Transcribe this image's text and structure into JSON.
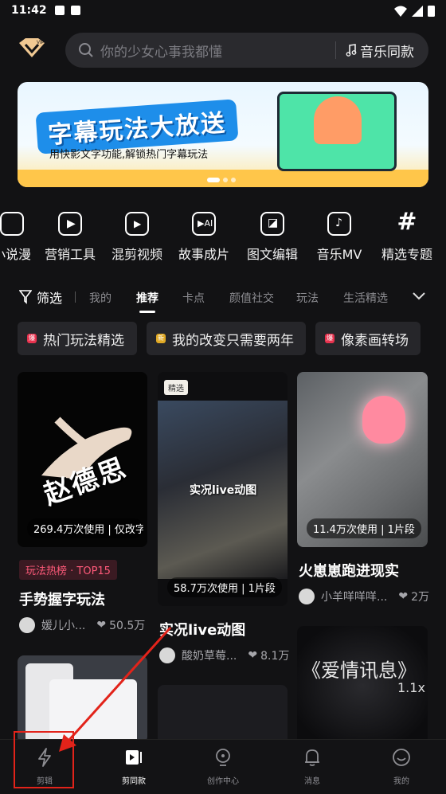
{
  "status": {
    "time": "11:42"
  },
  "search": {
    "placeholder": "你的少女心事我都懂",
    "music_same": "音乐同款"
  },
  "banner": {
    "title": "字幕玩法大放送",
    "subtitle": "用快影文字功能,解锁热门字幕玩法"
  },
  "tools": [
    {
      "label": "小说漫",
      "icon": "novel-comic-icon"
    },
    {
      "label": "营销工具",
      "icon": "marketing-tool-icon"
    },
    {
      "label": "混剪视频",
      "icon": "mix-video-icon"
    },
    {
      "label": "故事成片",
      "icon": "story-video-icon"
    },
    {
      "label": "图文编辑",
      "icon": "image-text-edit-icon"
    },
    {
      "label": "音乐MV",
      "icon": "music-mv-icon"
    },
    {
      "label": "精选专题",
      "icon": "hashtag-icon"
    }
  ],
  "filter": {
    "label": "筛选",
    "tabs": [
      "我的",
      "推荐",
      "卡点",
      "颜值社交",
      "玩法",
      "生活精选"
    ],
    "active": "推荐"
  },
  "chips": [
    {
      "label": "热门玩法精选",
      "badge": "爆",
      "color": "#e8334f"
    },
    {
      "label": "我的改变只需要两年",
      "badge": "新",
      "color": "#e0a925"
    },
    {
      "label": "像素画转场",
      "badge": "爆",
      "color": "#e8334f"
    }
  ],
  "cards": {
    "c1": {
      "stat": "269.4万次使用 | 仅改字",
      "overlay": "赵德思",
      "rank": "玩法热榜 · TOP15",
      "title": "手势握字玩法",
      "author": "媛儿小...",
      "likes": "50.5万"
    },
    "c2": {
      "tag": "精选",
      "overlay": "实况live动图",
      "stat": "58.7万次使用 | 1片段",
      "title": "实况live动图",
      "author": "酸奶草莓...",
      "likes": "8.1万"
    },
    "c3": {
      "stat": "11.4万次使用 | 1片段",
      "title": "火崽崽跑进现实",
      "author": "小羊咩咩咩...",
      "likes": "2万"
    },
    "c6": {
      "overlay": "《爱情讯息》",
      "overlay_sub": "1.1x"
    }
  },
  "nav": [
    {
      "label": "剪辑",
      "icon": "lightning-icon"
    },
    {
      "label": "剪同款",
      "icon": "template-video-icon"
    },
    {
      "label": "创作中心",
      "icon": "creator-bulb-icon"
    },
    {
      "label": "消息",
      "icon": "bell-icon"
    },
    {
      "label": "我的",
      "icon": "smile-profile-icon"
    }
  ],
  "nav_active": "剪同款",
  "colors": {
    "background": "#121214",
    "annotation": "#e2231a",
    "rank_badge": "#d9304a"
  }
}
